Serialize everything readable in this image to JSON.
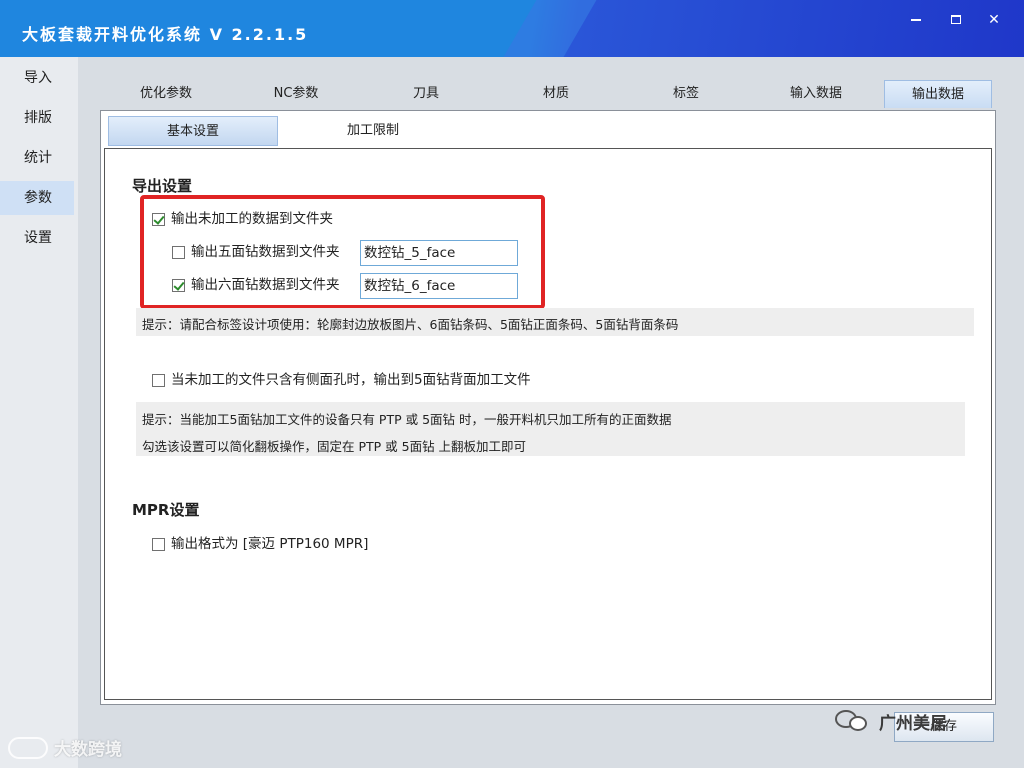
{
  "window": {
    "title": "大板套裁开料优化系统 V 2.2.1.5",
    "minimize_icon": "minimize-icon",
    "maximize_icon": "maximize-icon",
    "close_label": "✕"
  },
  "sidebar": {
    "items": [
      {
        "label": "导入",
        "active": false
      },
      {
        "label": "排版",
        "active": false
      },
      {
        "label": "统计",
        "active": false
      },
      {
        "label": "参数",
        "active": true
      },
      {
        "label": "设置",
        "active": false
      }
    ]
  },
  "tabs": [
    {
      "label": "优化参数",
      "active": false
    },
    {
      "label": "NC参数",
      "active": false
    },
    {
      "label": "刀具",
      "active": false
    },
    {
      "label": "材质",
      "active": false
    },
    {
      "label": "标签",
      "active": false
    },
    {
      "label": "输入数据",
      "active": false
    },
    {
      "label": "输出数据",
      "active": true
    }
  ],
  "subtabs": [
    {
      "label": "基本设置",
      "active": true
    },
    {
      "label": "加工限制",
      "active": false
    }
  ],
  "export_settings": {
    "title": "导出设置",
    "unprocessed": {
      "label": "输出未加工的数据到文件夹",
      "checked": true
    },
    "five_face": {
      "label": "输出五面钻数据到文件夹",
      "checked": false,
      "value": "数控钻_5_face"
    },
    "six_face": {
      "label": "输出六面钻数据到文件夹",
      "checked": true,
      "value": "数控钻_6_face"
    },
    "hint1": "提示：请配合标签设计项使用：轮廓封边放板图片、6面钻条码、5面钻正面条码、5面钻背面条码",
    "side_hole": {
      "label": "当未加工的文件只含有侧面孔时，输出到5面钻背面加工文件",
      "checked": false
    },
    "hint2_line1": "提示：当能加工5面钻加工文件的设备只有 PTP 或 5面钻 时，一般开料机只加工所有的正面数据",
    "hint2_line2": "勾选该设置可以简化翻板操作，固定在 PTP 或 5面钻 上翻板加工即可"
  },
  "mpr_settings": {
    "title": "MPR设置",
    "format": {
      "label": "输出格式为 [豪迈 PTP160 MPR]",
      "checked": false
    }
  },
  "bottom_button": {
    "label": "保存"
  },
  "watermarks": {
    "left": "大数跨境",
    "right": "广州美居"
  },
  "colors": {
    "titlebar": "#1f86df",
    "highlight_box": "#e02424",
    "check_mark": "#2d8b2d"
  }
}
